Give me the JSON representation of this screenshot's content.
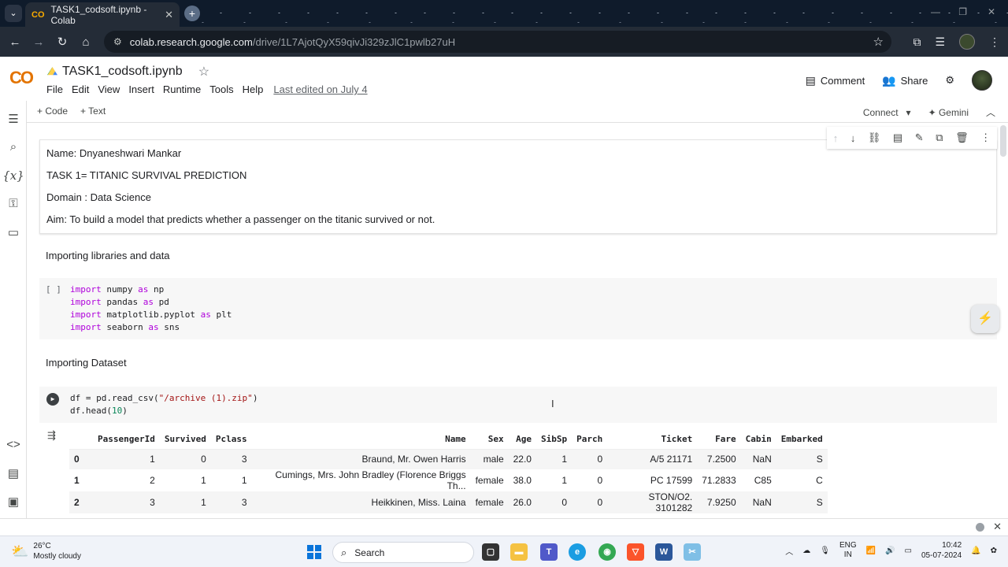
{
  "browser": {
    "tab_title": "TASK1_codsoft.ipynb - Colab",
    "tab_favicon": "CO",
    "url_host": "colab.research.google.com",
    "url_path": "/drive/1L7AjotQyX59qivJi329zJlC1pwlb27uH"
  },
  "colab": {
    "logo": "CO",
    "notebook_title": "TASK1_codsoft.ipynb",
    "menu": [
      "File",
      "Edit",
      "View",
      "Insert",
      "Runtime",
      "Tools",
      "Help"
    ],
    "last_edited": "Last edited on July 4",
    "comment_label": "Comment",
    "share_label": "Share",
    "add_code": "+ Code",
    "add_text": "+ Text",
    "connect_label": "Connect",
    "gemini_label": "Gemini"
  },
  "text_cell": {
    "lines": [
      "Name: Dnyaneshwari Mankar",
      "TASK 1= TITANIC SURVIVAL PREDICTION",
      "Domain : Data Science",
      "Aim: To build a model that predicts whether a passenger on the titanic survived or not."
    ]
  },
  "section1_title": "Importing libraries and data",
  "code1": {
    "gutter": "[ ]",
    "lines": [
      [
        "import",
        " numpy ",
        "as",
        " np"
      ],
      [
        "import",
        " pandas ",
        "as",
        " pd"
      ],
      [
        "import",
        " matplotlib.pyplot ",
        "as",
        " plt"
      ],
      [
        "import",
        " seaborn ",
        "as",
        " sns"
      ]
    ]
  },
  "section2_title": "Importing Dataset",
  "code2": {
    "line1_a": "df = pd.read_csv(",
    "line1_str": "\"/archive (1).zip\"",
    "line1_b": ")",
    "line2_a": "df.head(",
    "line2_num": "10",
    "line2_b": ")"
  },
  "dataframe": {
    "columns": [
      "",
      "PassengerId",
      "Survived",
      "Pclass",
      "Name",
      "Sex",
      "Age",
      "SibSp",
      "Parch",
      "Ticket",
      "Fare",
      "Cabin",
      "Embarked"
    ],
    "rows": [
      [
        "0",
        "1",
        "0",
        "3",
        "Braund, Mr. Owen Harris",
        "male",
        "22.0",
        "1",
        "0",
        "A/5 21171",
        "7.2500",
        "NaN",
        "S"
      ],
      [
        "1",
        "2",
        "1",
        "1",
        "Cumings, Mrs. John Bradley (Florence Briggs Th...",
        "female",
        "38.0",
        "1",
        "0",
        "PC 17599",
        "71.2833",
        "C85",
        "C"
      ],
      [
        "2",
        "3",
        "1",
        "3",
        "Heikkinen, Miss. Laina",
        "female",
        "26.0",
        "0",
        "0",
        "STON/O2. 3101282",
        "7.9250",
        "NaN",
        "S"
      ]
    ]
  },
  "taskbar": {
    "temp": "26°C",
    "weather": "Mostly cloudy",
    "search": "Search",
    "lang1": "ENG",
    "lang2": "IN",
    "time": "10:42",
    "date": "05-07-2024"
  },
  "colors": {
    "colab_orange": "#f9ab00",
    "keyword": "#af00db",
    "string": "#a31515",
    "chrome_dark": "#242c37"
  }
}
